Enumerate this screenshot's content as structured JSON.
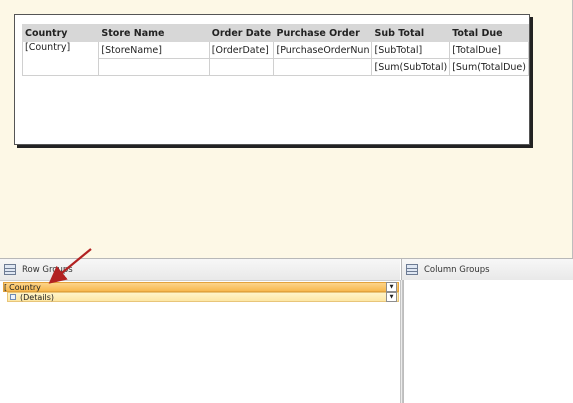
{
  "tablix": {
    "headers": [
      "Country",
      "Store Name",
      "Order Date",
      "Purchase Order",
      "Sub Total",
      "Total Due"
    ],
    "detail_row": [
      "[Country]",
      "[StoreName]",
      "[OrderDate]",
      "[PurchaseOrderNun",
      "[SubTotal]",
      "[TotalDue]"
    ],
    "total_row": [
      "",
      "",
      "",
      "",
      "[Sum(SubTotal)",
      "[Sum(TotalDue)"
    ]
  },
  "row_groups": {
    "title": "Row Groups",
    "icon": "row-groups-icon",
    "items": [
      {
        "bracket": "[",
        "label": "Country",
        "dropdown_icon": "chevron-down-icon"
      },
      {
        "label": "(Details)",
        "dropdown_icon": "chevron-down-icon"
      }
    ]
  },
  "column_groups": {
    "title": "Column Groups",
    "icon": "column-groups-icon"
  },
  "colors": {
    "design_background": "#fdf8e6",
    "header_fill": "#d7d7d7",
    "group_selected": "#f7b84e",
    "group_details": "#fde7a5",
    "arrow": "#b22222"
  }
}
